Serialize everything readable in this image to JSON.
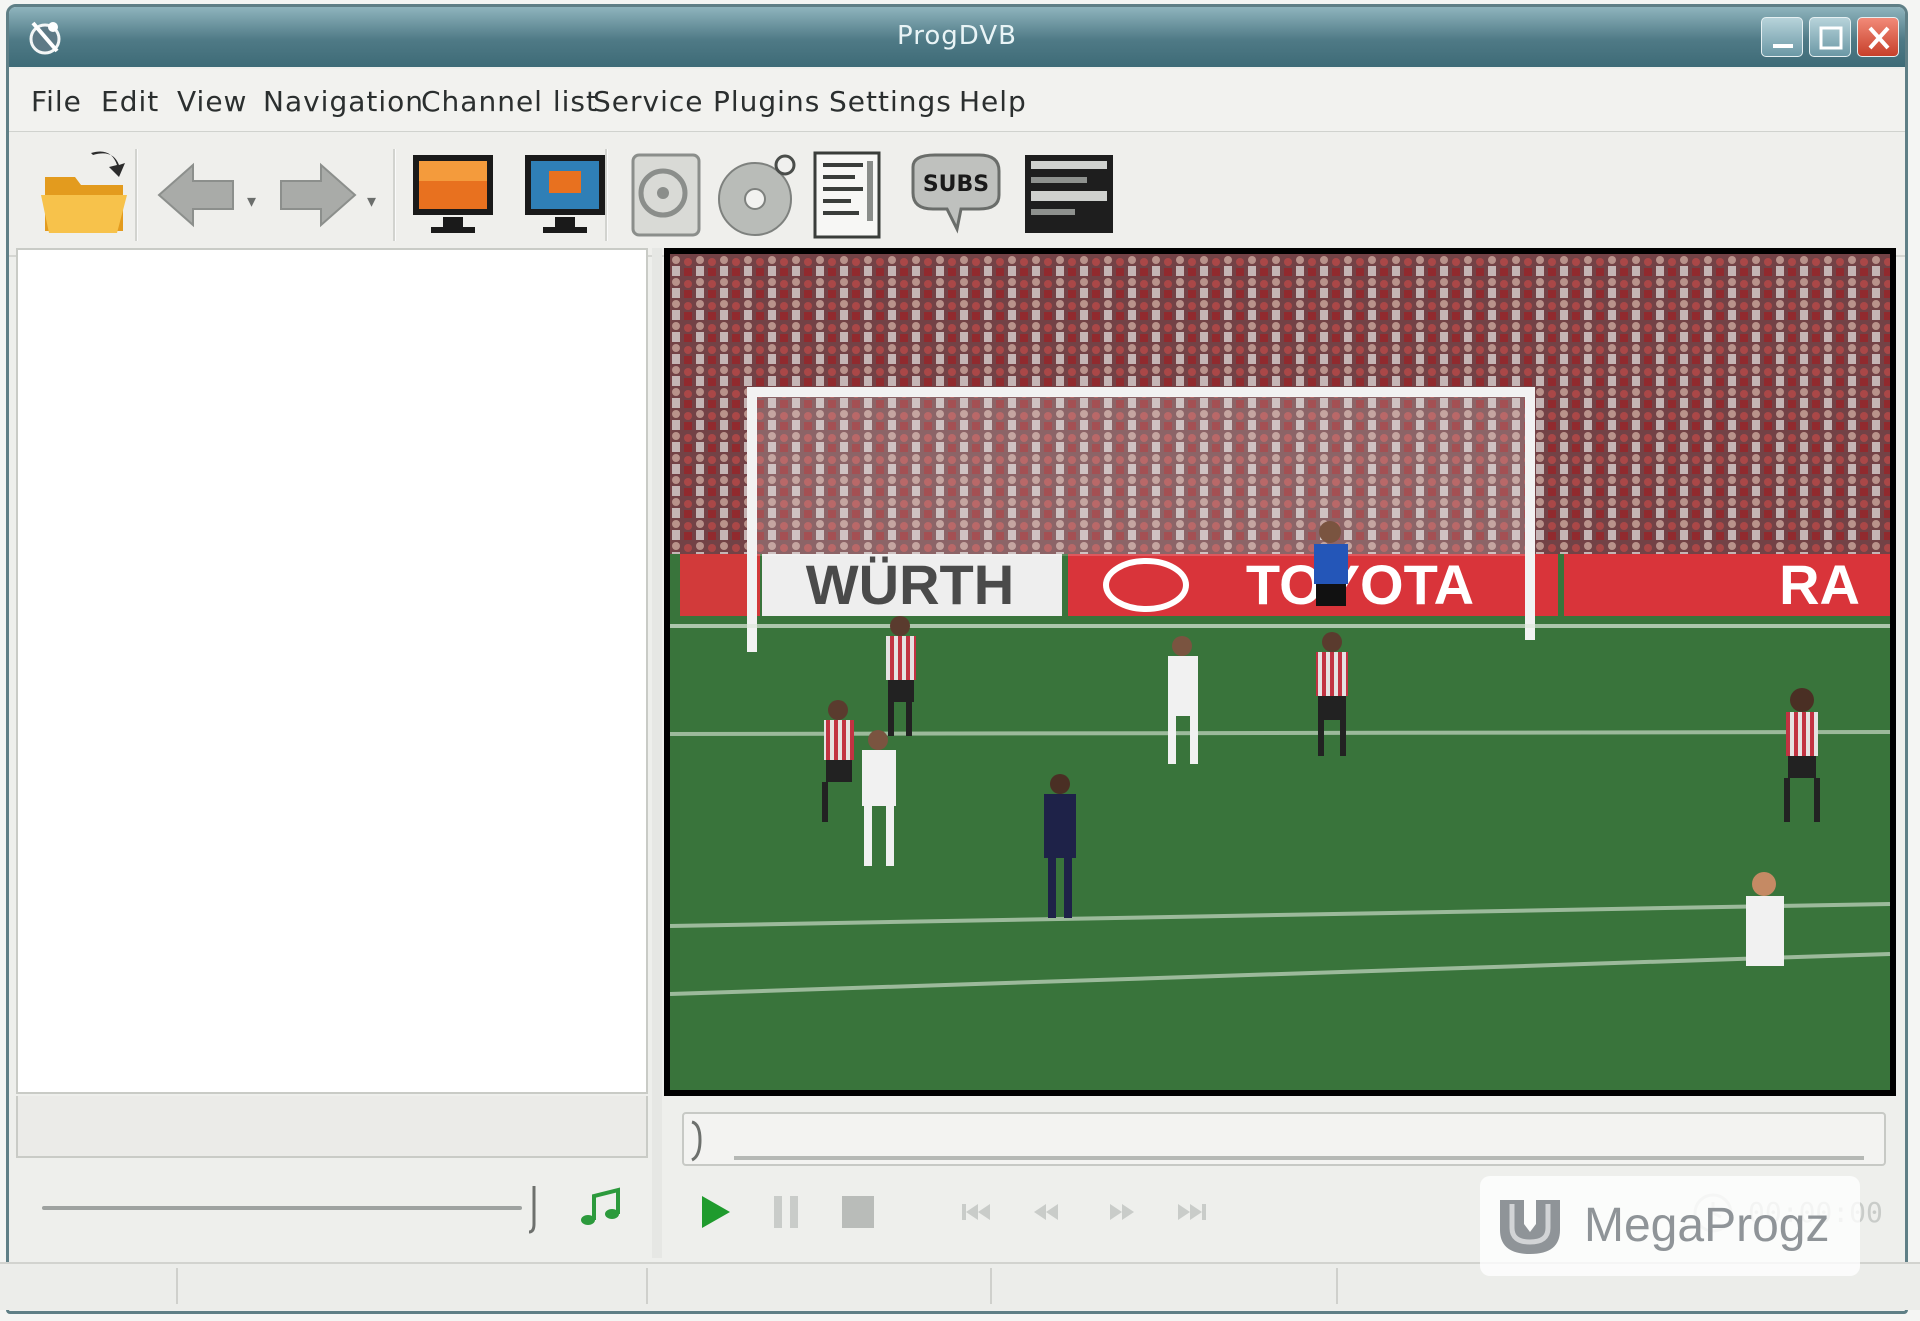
{
  "window": {
    "title": "ProgDVB"
  },
  "menu": [
    "File",
    "Edit",
    "View",
    "Navigation",
    "Channel list",
    "Service",
    "Plugins",
    "Settings",
    "Help"
  ],
  "toolbar": {
    "buttons": [
      "open-folder-icon",
      "back-arrow-icon",
      "forward-arrow-icon",
      "tv-screen-icon",
      "monitor-icon",
      "disk-settings-icon",
      "cd-record-icon",
      "epg-document-icon",
      "subtitles-icon",
      "teletext-icon"
    ],
    "subtitles_label": "SUBS"
  },
  "video": {
    "ad_board": [
      "WÜRTH",
      "TOYOTA",
      "RA"
    ]
  },
  "playback": {
    "timecode": "00:00:00",
    "seek_progress": 0.0
  },
  "watermark": {
    "text": "MegaProgz"
  },
  "colors": {
    "titlebar": "#4f7a86",
    "play_green": "#1f9b2d",
    "close_red": "#c7402b"
  }
}
